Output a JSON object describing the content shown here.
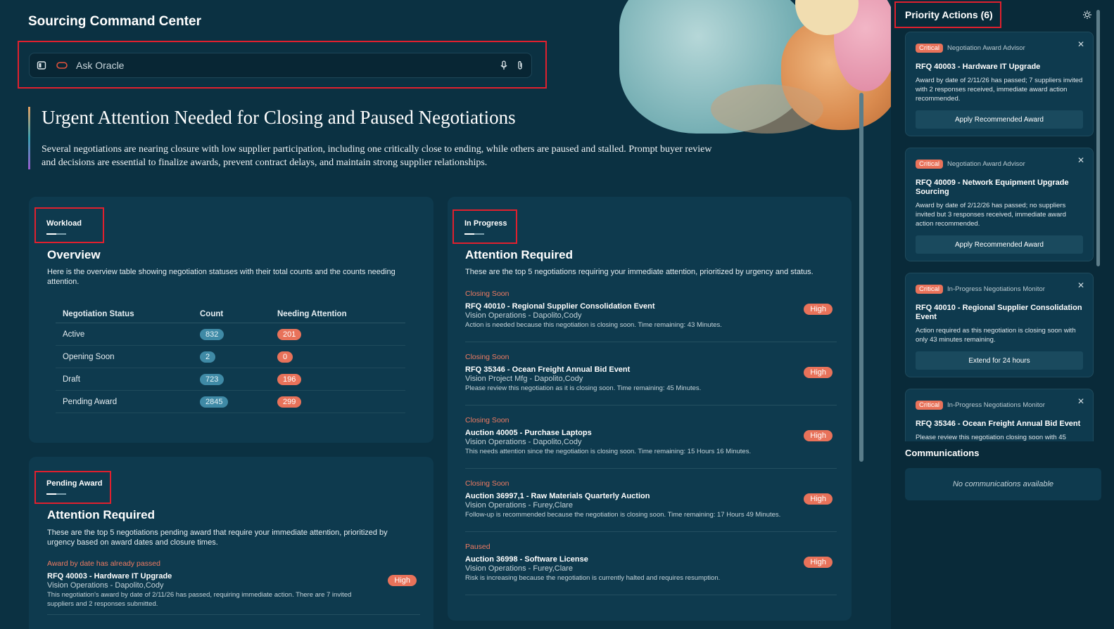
{
  "header": {
    "title": "Sourcing Command Center"
  },
  "ask": {
    "placeholder": "Ask Oracle"
  },
  "headline": {
    "title": "Urgent Attention Needed for Closing and Paused Negotiations",
    "body": "Several negotiations are nearing closure with low supplier participation, including one critically close to ending, while others are paused and stalled. Prompt buyer review and decisions are essential to finalize awards, prevent contract delays, and maintain strong supplier relationships."
  },
  "workload": {
    "tab": "Workload",
    "heading": "Overview",
    "description": "Here is the overview table showing negotiation statuses with their total counts and the counts needing attention.",
    "columns": [
      "Negotiation Status",
      "Count",
      "Needing Attention"
    ],
    "rows": [
      {
        "status": "Active",
        "count": "832",
        "attention": "201"
      },
      {
        "status": "Opening Soon",
        "count": "2",
        "attention": "0"
      },
      {
        "status": "Draft",
        "count": "723",
        "attention": "196"
      },
      {
        "status": "Pending Award",
        "count": "2845",
        "attention": "299"
      }
    ]
  },
  "pending_award": {
    "tab": "Pending Award",
    "heading": "Attention Required",
    "description": "These are the top 5 negotiations pending award that require your immediate attention, prioritized by urgency based on award dates and closure times.",
    "items": [
      {
        "category": "Award by date has already passed",
        "title": "RFQ 40003 - Hardware IT Upgrade",
        "sub": "Vision Operations - Dapolito,Cody",
        "note": "This negotiation's award by date of 2/11/26 has passed, requiring immediate action. There are 7 invited suppliers and 2 responses submitted.",
        "priority": "High"
      }
    ]
  },
  "in_progress": {
    "tab": "In Progress",
    "heading": "Attention Required",
    "description": "These are the top 5 negotiations requiring your immediate attention, prioritized by urgency and status.",
    "items": [
      {
        "category": "Closing Soon",
        "title": "RFQ 40010 - Regional Supplier Consolidation Event",
        "sub": "Vision Operations - Dapolito,Cody",
        "note": "Action is needed because this negotiation is closing soon. Time remaining: 43 Minutes.",
        "priority": "High"
      },
      {
        "category": "Closing Soon",
        "title": "RFQ 35346 - Ocean Freight Annual Bid Event",
        "sub": "Vision Project Mfg - Dapolito,Cody",
        "note": "Please review this negotiation as it is closing soon. Time remaining: 45 Minutes.",
        "priority": "High"
      },
      {
        "category": "Closing Soon",
        "title": "Auction 40005 - Purchase Laptops",
        "sub": "Vision Operations - Dapolito,Cody",
        "note": "This needs attention since the negotiation is closing soon. Time remaining: 15 Hours 16 Minutes.",
        "priority": "High"
      },
      {
        "category": "Closing Soon",
        "title": "Auction 36997,1 - Raw Materials Quarterly Auction",
        "sub": "Vision Operations - Furey,Clare",
        "note": "Follow-up is recommended because the negotiation is closing soon. Time remaining: 17 Hours 49 Minutes.",
        "priority": "High"
      },
      {
        "category": "Paused",
        "title": "Auction 36998 -  Software License",
        "sub": "Vision Operations - Furey,Clare",
        "note": "Risk is increasing because the negotiation is currently halted and requires resumption.",
        "priority": "High"
      }
    ]
  },
  "priority_actions": {
    "title": "Priority Actions (6)",
    "cards": [
      {
        "severity": "Critical",
        "source": "Negotiation Award Advisor",
        "title": "RFQ 40003 - Hardware IT Upgrade",
        "description": "Award by date of 2/11/26 has passed; 7 suppliers invited with 2 responses received, immediate award action recommended.",
        "action": "Apply Recommended Award"
      },
      {
        "severity": "Critical",
        "source": "Negotiation Award Advisor",
        "title": "RFQ 40009 - Network Equipment Upgrade Sourcing",
        "description": "Award by date of 2/12/26 has passed; no suppliers invited but 3 responses received, immediate award action recommended.",
        "action": "Apply Recommended Award"
      },
      {
        "severity": "Critical",
        "source": "In-Progress Negotiations Monitor",
        "title": "RFQ 40010 - Regional Supplier Consolidation Event",
        "description": "Action required as this negotiation is closing soon with only 43 minutes remaining.",
        "action": "Extend for 24 hours"
      },
      {
        "severity": "Critical",
        "source": "In-Progress Negotiations Monitor",
        "title": "RFQ 35346 - Ocean Freight Annual Bid Event",
        "description": "Please review this negotiation closing soon with 45",
        "action": ""
      }
    ]
  },
  "communications": {
    "title": "Communications",
    "empty": "No communications available"
  },
  "colors": {
    "background": "#0b3142",
    "card": "#0e3a4e",
    "accent_red": "#e8725a",
    "count_pill": "#3f8aa6",
    "highlight_box": "#e0202e"
  }
}
